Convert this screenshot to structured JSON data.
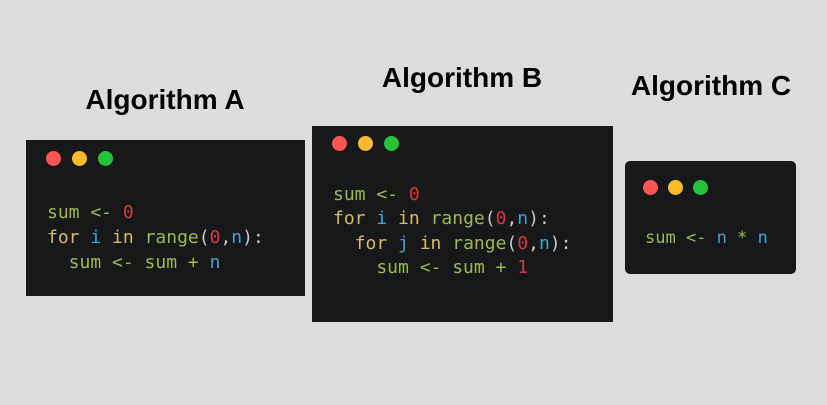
{
  "colors": {
    "background": "#dcdcdc",
    "panel": "#17181a",
    "dot_red": "#fd5652",
    "dot_yellow": "#fdb92c",
    "dot_green": "#26c33a",
    "var": "#9aba50",
    "keyword": "#d6bb63",
    "identifier": "#3ea4d3",
    "number": "#d6373f",
    "punctuation": "#c9c9c9"
  },
  "panels": [
    {
      "title": "Algorithm A",
      "lines": [
        [
          [
            "sum <- ",
            "var"
          ],
          [
            "0",
            "num"
          ]
        ],
        [
          [
            "for ",
            "kw"
          ],
          [
            "i ",
            "id"
          ],
          [
            "in ",
            "kw"
          ],
          [
            "range",
            "var"
          ],
          [
            "(",
            "punc"
          ],
          [
            "0",
            "num"
          ],
          [
            ",",
            "punc"
          ],
          [
            "n",
            "id"
          ],
          [
            "):",
            "punc"
          ]
        ],
        [
          [
            "  sum <- sum + ",
            "var"
          ],
          [
            "n",
            "id"
          ]
        ]
      ]
    },
    {
      "title": "Algorithm B",
      "lines": [
        [
          [
            "sum <- ",
            "var"
          ],
          [
            "0",
            "num"
          ]
        ],
        [
          [
            "for ",
            "kw"
          ],
          [
            "i ",
            "id"
          ],
          [
            "in ",
            "kw"
          ],
          [
            "range",
            "var"
          ],
          [
            "(",
            "punc"
          ],
          [
            "0",
            "num"
          ],
          [
            ",",
            "punc"
          ],
          [
            "n",
            "id"
          ],
          [
            "):",
            "punc"
          ]
        ],
        [
          [
            "  for ",
            "kw"
          ],
          [
            "j ",
            "id"
          ],
          [
            "in ",
            "kw"
          ],
          [
            "range",
            "var"
          ],
          [
            "(",
            "punc"
          ],
          [
            "0",
            "num"
          ],
          [
            ",",
            "punc"
          ],
          [
            "n",
            "id"
          ],
          [
            "):",
            "punc"
          ]
        ],
        [
          [
            "    sum <- sum + ",
            "var"
          ],
          [
            "1",
            "num"
          ]
        ]
      ]
    },
    {
      "title": "Algorithm C",
      "lines": [
        [
          [
            "sum <- ",
            "var"
          ],
          [
            "n ",
            "id"
          ],
          [
            "* ",
            "var"
          ],
          [
            "n",
            "id"
          ]
        ]
      ]
    }
  ]
}
